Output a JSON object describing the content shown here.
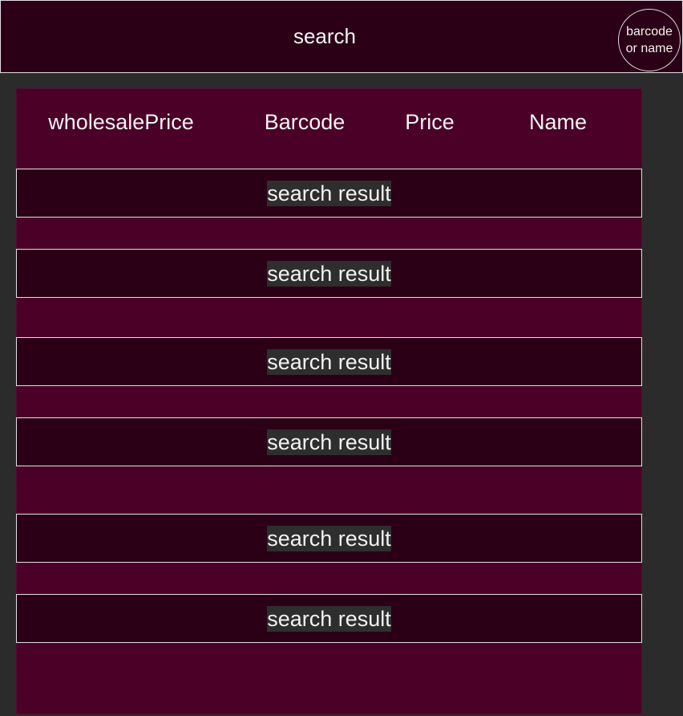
{
  "search": {
    "label": "search",
    "mode_button_label": "barcode or name"
  },
  "table": {
    "columns": [
      "wholesalePrice",
      "Barcode",
      "Price",
      "Name"
    ],
    "rows": [
      "search result",
      "search result",
      "search result",
      "search result",
      "search result",
      "search result"
    ]
  },
  "colors": {
    "background": "#2b2b2b",
    "panel": "#4b0028",
    "row": "#2b0016",
    "text": "#f2f2f2",
    "text_highlight": "#2e2e2e"
  }
}
